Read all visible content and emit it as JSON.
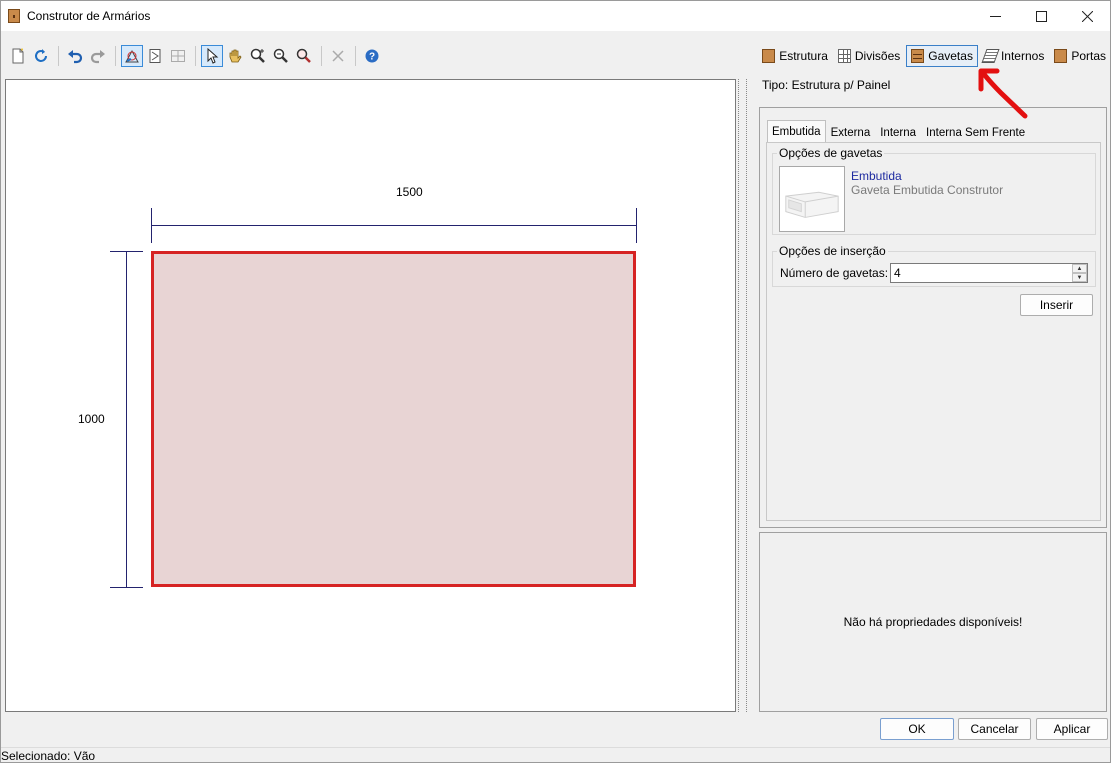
{
  "window": {
    "title": "Construtor de Armários",
    "controls": [
      "minimize-icon",
      "maximize-icon",
      "close-icon"
    ]
  },
  "toolbar": {
    "left_buttons": [
      {
        "name": "new-icon"
      },
      {
        "name": "refresh-icon"
      },
      {
        "name": "undo-icon"
      },
      {
        "name": "redo-icon"
      },
      {
        "name": "draw-shape-icon"
      },
      {
        "name": "resize-icon"
      },
      {
        "name": "grid-icon"
      },
      {
        "name": "pointer-icon"
      },
      {
        "name": "pan-hand-icon"
      },
      {
        "name": "zoom-in-icon"
      },
      {
        "name": "zoom-out-icon"
      },
      {
        "name": "zoom-fit-icon"
      },
      {
        "name": "delete-icon"
      },
      {
        "name": "help-icon"
      }
    ],
    "right_tools": [
      {
        "label": "Estrutura",
        "icon": "estrutura-icon"
      },
      {
        "label": "Divisões",
        "icon": "divisoes-icon"
      },
      {
        "label": "Gavetas",
        "icon": "gavetas-icon",
        "active": true
      },
      {
        "label": "Internos",
        "icon": "internos-icon"
      },
      {
        "label": "Portas",
        "icon": "portas-icon"
      }
    ]
  },
  "canvas": {
    "width_label": "1500",
    "height_label": "1000",
    "panel_fill": "#e8d4d4",
    "panel_border": "#d62323",
    "dimension_color": "#23236e"
  },
  "right_panel": {
    "tipo": "Tipo: Estrutura p/ Painel",
    "tabs": [
      "Embutida",
      "Externa",
      "Interna",
      "Interna Sem Frente"
    ],
    "active_tab": "Embutida",
    "drawer_options": {
      "title": "Opções de gavetas",
      "item_name": "Embutida",
      "item_desc": "Gaveta Embutida Construtor"
    },
    "insert_options": {
      "title": "Opções de inserção",
      "count_label": "Número de gavetas:",
      "count_value": "4"
    },
    "insert_button": "Inserir",
    "no_props": "Não há propriedades disponíveis!"
  },
  "footer": {
    "ok": "OK",
    "cancel": "Cancelar",
    "apply": "Aplicar"
  },
  "status": "Selecionado: Vão",
  "annotation_color": "#e31010"
}
